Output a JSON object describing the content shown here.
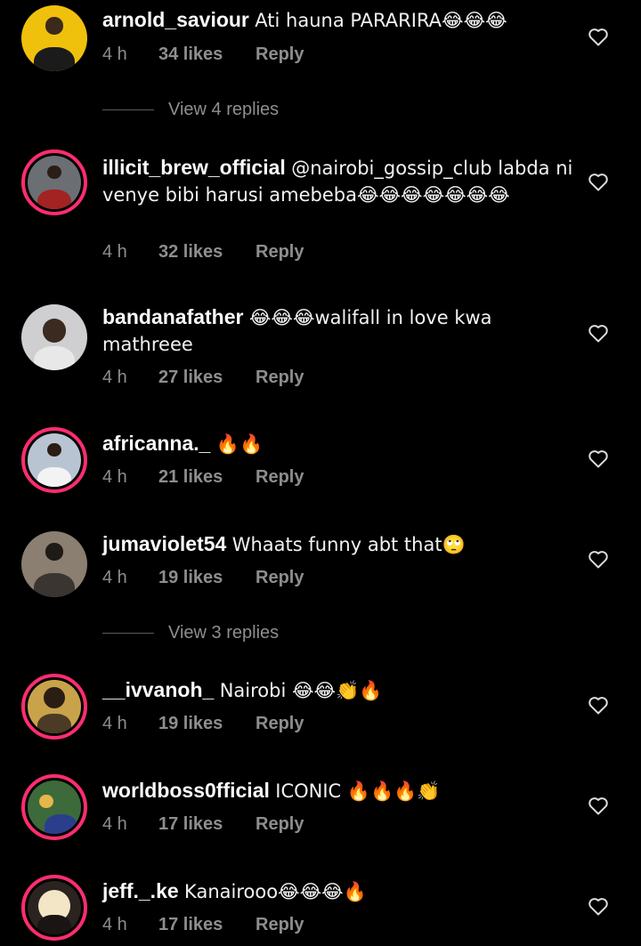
{
  "heart_icon": "heart-outline-icon",
  "colors": {
    "background": "#000000",
    "muted": "#8e8e8e",
    "story_ring": "#ff2d6f"
  },
  "comments": [
    {
      "username": "arnold_saviour",
      "text": "Ati hauna PARARIRA😂😂😂",
      "time": "4 h",
      "likes": "34 likes",
      "reply": "Reply"
    },
    {
      "username": "illicit_brew_official",
      "text": "@nairobi_gossip_club labda ni venye bibi harusi amebeba😂😂😂😂😂😂😂",
      "time": "4 h",
      "likes": "32 likes",
      "reply": "Reply"
    },
    {
      "username": "bandanafather",
      "text": "😂😂😂walifall in love kwa mathreee",
      "time": "4 h",
      "likes": "27 likes",
      "reply": "Reply"
    },
    {
      "username": "africanna._",
      "text": "🔥🔥",
      "time": "4 h",
      "likes": "21 likes",
      "reply": "Reply"
    },
    {
      "username": "jumaviolet54",
      "text": "Whaats funny abt that🙄",
      "time": "4 h",
      "likes": "19 likes",
      "reply": "Reply"
    },
    {
      "username": "__ivvanoh_",
      "text": "Nairobi 😂😂👏🔥",
      "time": "4 h",
      "likes": "19 likes",
      "reply": "Reply"
    },
    {
      "username": "worldboss0fficial",
      "text": "ICONIC 🔥🔥🔥👏",
      "time": "4 h",
      "likes": "17 likes",
      "reply": "Reply"
    },
    {
      "username": "jeff._.ke",
      "text": "Kanairooo😂😂😂🔥",
      "time": "4 h",
      "likes": "17 likes",
      "reply": "Reply"
    }
  ],
  "view_replies": [
    {
      "label": "View 4 replies"
    },
    {
      "label": "View 3 replies"
    }
  ]
}
